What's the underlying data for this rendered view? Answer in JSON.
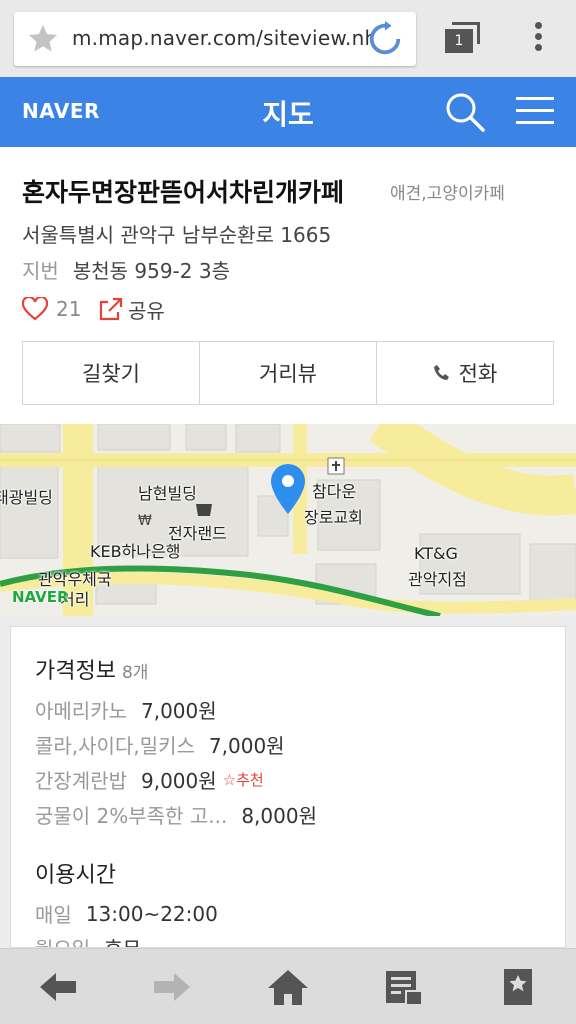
{
  "browser": {
    "url": "m.map.naver.com/siteview.nh",
    "tab_count": "1",
    "icons": {
      "bookmark": "star-icon",
      "reload": "reload-icon",
      "tabs": "tabs-icon",
      "overflow": "overflow-menu-icon"
    }
  },
  "header": {
    "logo": "NAVER",
    "title": "지도",
    "icons": {
      "search": "search-icon",
      "menu": "hamburger-menu-icon"
    },
    "color": "#3b84e5"
  },
  "place": {
    "name": "혼자두면장판뜯어서차린개카페",
    "category": "애견,고양이카페",
    "address": "서울특별시 관악구 남부순환로 1665",
    "lot_label": "지번",
    "lot_address": "봉천동 959-2 3층",
    "likes": "21",
    "share_label": "공유",
    "actions": {
      "directions": "길찾기",
      "street_view": "거리뷰",
      "call": "전화"
    },
    "accent_color": "#e8413a"
  },
  "map": {
    "labels": {
      "taegwang": "태광빌딩",
      "namhyeon": "남현빌딩",
      "jeonja": "전자랜드",
      "keb": "KEB하나은행",
      "post": "관악우체국",
      "street": "거리",
      "chamdaun1": "참다운",
      "chamdaun2": "장로교회",
      "ktg1": "KT&G",
      "ktg2": "관악지점"
    },
    "logo": "NAVER",
    "marker_color": "#2e8ef0"
  },
  "info": {
    "price": {
      "title": "가격정보",
      "count": "8개",
      "items": [
        {
          "name": "아메리카노",
          "price": "7,000원",
          "badge": ""
        },
        {
          "name": "콜라,사이다,밀키스",
          "price": "7,000원",
          "badge": ""
        },
        {
          "name": "간장계란밥",
          "price": "9,000원",
          "badge": "☆추천"
        },
        {
          "name": "궁물이 2%부족한 고...",
          "price": "8,000원",
          "badge": ""
        }
      ]
    },
    "hours": {
      "title": "이용시간",
      "items": [
        {
          "name": "매일",
          "value": "13:00~22:00"
        },
        {
          "name": "월요일",
          "value": "휴무"
        }
      ]
    }
  },
  "bottom_bar": {
    "icons": [
      "back-arrow-icon",
      "forward-arrow-icon",
      "home-icon",
      "reader-icon",
      "bookmarks-icon"
    ]
  }
}
